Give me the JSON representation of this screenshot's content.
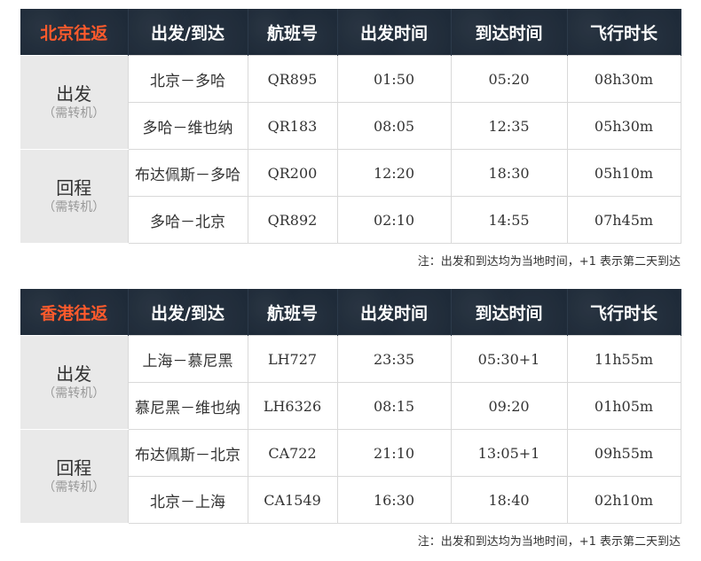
{
  "headers": [
    "出发/到达",
    "航班号",
    "出发时间",
    "到达时间",
    "飞行时长"
  ],
  "note": "注：出发和到达均为当地时间，+1 表示第二天到达",
  "sections": [
    {
      "title": "北京往返",
      "legs": [
        {
          "label": "出发",
          "sub": "（需转机）",
          "rows": [
            {
              "route": "北京－多哈",
              "flight": "QR895",
              "depart": "01:50",
              "arrive": "05:20",
              "duration": "08h30m"
            },
            {
              "route": "多哈－维也纳",
              "flight": "QR183",
              "depart": "08:05",
              "arrive": "12:35",
              "duration": "05h30m"
            }
          ]
        },
        {
          "label": "回程",
          "sub": "（需转机）",
          "rows": [
            {
              "route": "布达佩斯－多哈",
              "flight": "QR200",
              "depart": "12:20",
              "arrive": "18:30",
              "duration": "05h10m"
            },
            {
              "route": "多哈－北京",
              "flight": "QR892",
              "depart": "02:10",
              "arrive": "14:55",
              "duration": "07h45m"
            }
          ]
        }
      ]
    },
    {
      "title": "香港往返",
      "legs": [
        {
          "label": "出发",
          "sub": "（需转机）",
          "rows": [
            {
              "route": "上海－慕尼黑",
              "flight": "LH727",
              "depart": "23:35",
              "arrive": "05:30+1",
              "duration": "11h55m"
            },
            {
              "route": "慕尼黑－维也纳",
              "flight": "LH6326",
              "depart": "08:15",
              "arrive": "09:20",
              "duration": "01h05m"
            }
          ]
        },
        {
          "label": "回程",
          "sub": "（需转机）",
          "rows": [
            {
              "route": "布达佩斯－北京",
              "flight": "CA722",
              "depart": "21:10",
              "arrive": "13:05+1",
              "duration": "09h55m"
            },
            {
              "route": "北京－上海",
              "flight": "CA1549",
              "depart": "16:30",
              "arrive": "18:40",
              "duration": "02h10m"
            }
          ]
        }
      ]
    }
  ]
}
